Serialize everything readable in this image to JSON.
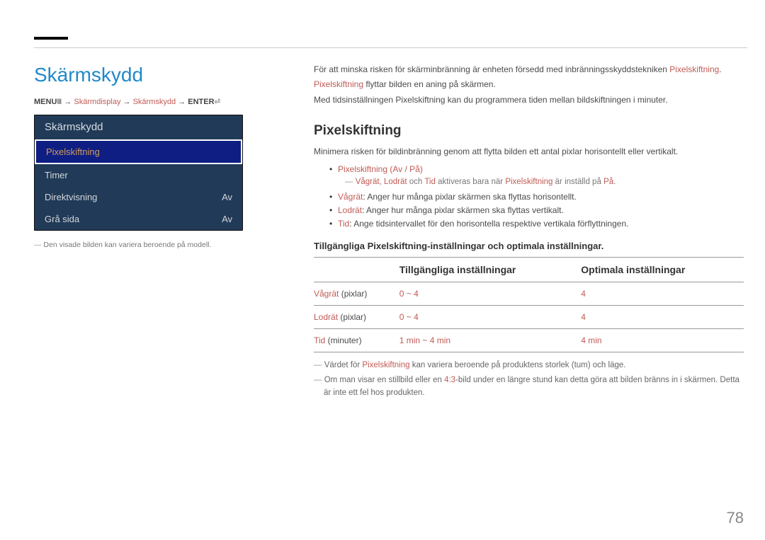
{
  "page_number": "78",
  "main_title": "Skärmskydd",
  "breadcrumb": {
    "menu": "MENU",
    "path_1": "Skärmdisplay",
    "path_2": "Skärmskydd",
    "enter": "ENTER"
  },
  "tv_panel": {
    "header": "Skärmskydd",
    "items": [
      {
        "label": "Pixelskiftning",
        "value": "",
        "selected": true
      },
      {
        "label": "Timer",
        "value": "",
        "selected": false
      },
      {
        "label": "Direktvisning",
        "value": "Av",
        "selected": false
      },
      {
        "label": "Grå sida",
        "value": "Av",
        "selected": false
      }
    ]
  },
  "left_footnote": "Den visade bilden kan variera beroende på modell.",
  "intro": {
    "p1_a": "För att minska risken för skärminbränning är enheten försedd med inbränningsskyddstekniken ",
    "p1_hl": "Pixelskiftning",
    "p1_b": ".",
    "p2_hl": "Pixelskiftning",
    "p2_a": " flyttar bilden en aning på skärmen.",
    "p3": "Med tidsinställningen Pixelskiftning kan du programmera tiden mellan bildskiftningen i minuter."
  },
  "section": {
    "title": "Pixelskiftning",
    "desc": "Minimera risken för bildinbränning genom att flytta bilden ett antal pixlar horisontellt eller vertikalt.",
    "bullets": [
      {
        "hl": "Pixelskiftning",
        "rest": " (Av / På)"
      }
    ],
    "subnote": {
      "a": "Vågrät",
      "b": "Lodrät",
      "c": "Tid",
      "mid": " aktiveras bara när ",
      "d": "Pixelskiftning",
      "end": " är inställd på ",
      "e": "På",
      "dot": "."
    },
    "bullets2": [
      {
        "hl": "Vågrät",
        "rest": ": Anger hur många pixlar skärmen ska flyttas horisontellt."
      },
      {
        "hl": "Lodrät",
        "rest": ": Anger hur många pixlar skärmen ska flyttas vertikalt."
      },
      {
        "hl": "Tid",
        "rest": ": Ange tidsintervallet för den horisontella respektive vertikala förflyttningen."
      }
    ],
    "sub_heading": "Tillgängliga Pixelskiftning-inställningar och optimala inställningar."
  },
  "table": {
    "headers": [
      "",
      "Tillgängliga inställningar",
      "Optimala inställningar"
    ],
    "rows": [
      {
        "label_hl": "Vågrät",
        "label_rest": " (pixlar)",
        "c1": "0 ~ 4",
        "c2": "4"
      },
      {
        "label_hl": "Lodrät",
        "label_rest": " (pixlar)",
        "c1": "0 ~ 4",
        "c2": "4"
      },
      {
        "label_hl": "Tid",
        "label_rest": " (minuter)",
        "c1": "1 min ~ 4 min",
        "c2": "4 min"
      }
    ]
  },
  "bottom_notes": {
    "n1_a": "Värdet för ",
    "n1_hl": "Pixelskiftning",
    "n1_b": " kan variera beroende på produktens storlek (tum) och läge.",
    "n2_a": "Om man visar en stillbild eller en ",
    "n2_hl": "4:3",
    "n2_b": "-bild under en längre stund kan detta göra att bilden bränns in i skärmen. Detta är inte ett fel hos produkten."
  }
}
